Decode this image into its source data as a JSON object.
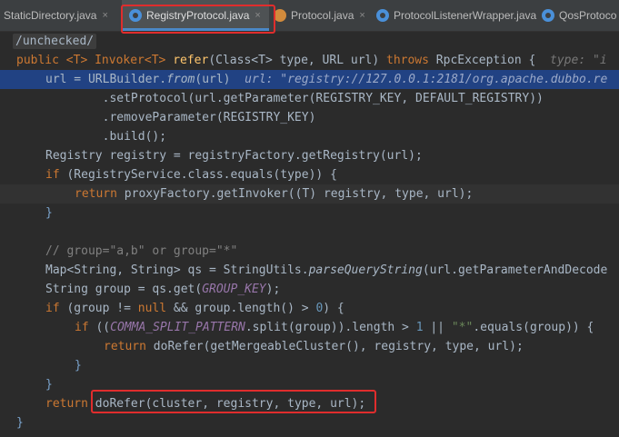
{
  "tabs": [
    {
      "label": "StaticDirectory.java"
    },
    {
      "label": "RegistryProtocol.java"
    },
    {
      "label": "Protocol.java"
    },
    {
      "label": "ProtocolListenerWrapper.java"
    },
    {
      "label": "QosProtoco"
    }
  ],
  "close_glyph": "×",
  "code": {
    "l0": "/unchecked/",
    "l1_a": "public <T> Invoker<T> ",
    "l1_fn": "refer",
    "l1_b": "(Class<T> type, URL url) ",
    "l1_kw": "throws",
    "l1_c": " RpcException {  ",
    "l1_hint": "type: \"i",
    "l2_a": "url = URLBuilder.",
    "l2_it": "from",
    "l2_b": "(url)  ",
    "l2_hint": "url: \"registry://127.0.0.1:2181/org.apache.dubbo.re",
    "l3": "        .setProtocol(url.getParameter(REGISTRY_KEY, DEFAULT_REGISTRY))",
    "l4": "        .removeParameter(REGISTRY_KEY)",
    "l5": "        .build();",
    "l6": "Registry registry = registryFactory.getRegistry(url);",
    "l7_kw": "if",
    "l7": " (RegistryService.class.equals(type)) {",
    "l8_kw": "return",
    "l8": " proxyFactory.getInvoker((T) registry, type, url);",
    "l9": "}",
    "l11": "// group=\"a,b\" or group=\"*\"",
    "l12_a": "Map<String, String> qs = StringUtils.",
    "l12_it": "parseQueryString",
    "l12_b": "(url.getParameterAndDecode",
    "l13_a": "String group = qs.get(",
    "l13_c": "GROUP_KEY",
    "l13_b": ");",
    "l14_kw": "if",
    "l14_a": " (group != ",
    "l14_null": "null",
    "l14_b": " && group.length() > ",
    "l14_num": "0",
    "l14_c": ") {",
    "l15_kw": "if",
    "l15_a": " ((",
    "l15_c": "COMMA_SPLIT_PATTERN",
    "l15_b": ".split(group)).length > ",
    "l15_num": "1",
    "l15_d": " || ",
    "l15_str": "\"*\"",
    "l15_e": ".equals(group)) {",
    "l16_kw": "return",
    "l16": " doRefer(getMergeableCluster(), registry, type, url);",
    "l17": "}",
    "l18": "}",
    "l19_kw": "return",
    "l19": " doRefer(cluster, registry, type, url);",
    "l20": "}"
  },
  "colors": {
    "highlight": "#214283",
    "red_box": "#e02d2d",
    "keyword": "#cc7832"
  }
}
